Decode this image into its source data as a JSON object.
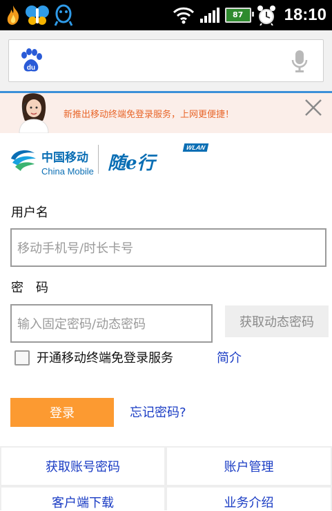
{
  "status_bar": {
    "time": "18:10",
    "battery": "87",
    "icons": [
      "flame-icon",
      "qq-butterfly-icon",
      "qq-penguin-icon",
      "wifi-icon",
      "signal-icon",
      "battery-icon",
      "alarm-icon"
    ]
  },
  "search": {
    "logo": "baidu-paw-icon",
    "placeholder": "",
    "mic": "microphone-icon"
  },
  "banner": {
    "message": "新推出移动终端免登录服务，上网更便捷！",
    "close": "close-icon"
  },
  "brand": {
    "china_mobile_cn": "中国移动",
    "china_mobile_en": "China Mobile",
    "sui_e_xing": "随e行",
    "wlan": "WLAN"
  },
  "form": {
    "username_label": "用户名",
    "username_placeholder": "移动手机号/时长卡号",
    "password_label": "密　码",
    "password_placeholder": "输入固定密码/动态密码",
    "dynamic_password_button": "获取动态密码",
    "free_login_label": "开通移动终端免登录服务",
    "intro_link": "简介",
    "login_button": "登录",
    "forgot_password": "忘记密码?"
  },
  "links": {
    "get_account": "获取账号密码",
    "account_management": "账户管理",
    "client_download": "客户端下载",
    "service_intro": "业务介绍"
  },
  "colors": {
    "accent_blue": "#3b8fd8",
    "link_blue": "#1a3cc4",
    "brand_blue": "#0a6eb4",
    "orange": "#fc9a31",
    "banner_text": "#e8662a"
  }
}
